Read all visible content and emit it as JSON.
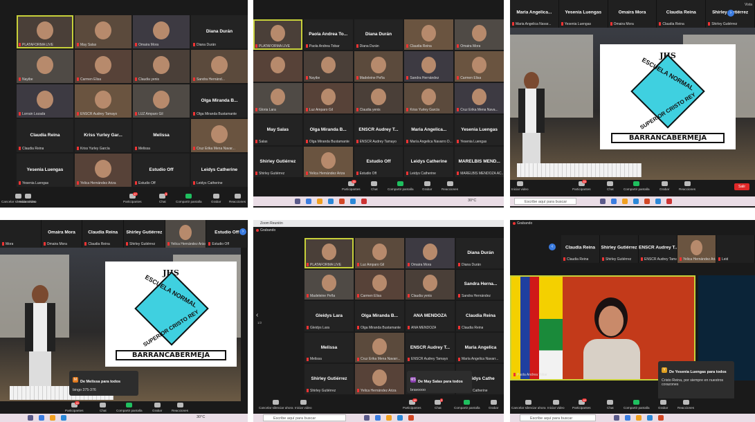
{
  "toolbar": {
    "stop_video": "Iniciar video",
    "cancel_mute": "Cancelar silenciar ahora",
    "participants": "Participantes",
    "chat": "Chat",
    "share": "Compartir pantalla",
    "record": "Grabar",
    "reactions": "Reacciones",
    "leave": "Salir",
    "participants_count_a": "47",
    "participants_count_b": "48",
    "chat_badge": "5"
  },
  "taskbar": {
    "search_placeholder": "Escribe aquí para buscar",
    "temperature": "30°C"
  },
  "window": {
    "title": "Zoom Reunión",
    "recording": "Grabando",
    "view": "Vista"
  },
  "panel1": {
    "tiles": [
      {
        "label": "PLATAFORMA LIVE",
        "name": "",
        "video": true,
        "hl": true
      },
      {
        "label": "May Salas",
        "name": "",
        "video": true
      },
      {
        "label": "Omaira Mora",
        "name": "",
        "video": true
      },
      {
        "label": "Diana Durán",
        "name": "Diana Durán",
        "video": false
      },
      {
        "label": "Nayibe",
        "name": "",
        "video": true
      },
      {
        "label": "Carmen Elisa",
        "name": "",
        "video": true
      },
      {
        "label": "Claudia yenis",
        "name": "",
        "video": true
      },
      {
        "label": "Sandra Hernánd...",
        "name": "",
        "video": true
      },
      {
        "label": "Lorrain Lozada",
        "name": "",
        "video": true
      },
      {
        "label": "ENSCR Audrey Tamayo",
        "name": "",
        "video": true
      },
      {
        "label": "LUZ Amparo Gil",
        "name": "",
        "video": true
      },
      {
        "label": "Olga Miranda Bustamante",
        "name": "Olga Miranda B...",
        "video": false
      },
      {
        "label": "Claudia Reina",
        "name": "Claudia Reina",
        "video": false
      },
      {
        "label": "Kriss Yurley García",
        "name": "Kriss Yurley Gar...",
        "video": false
      },
      {
        "label": "Melissa",
        "name": "Melissa",
        "video": false
      },
      {
        "label": "Cruz Erika Mena Navar...",
        "name": "",
        "video": true
      },
      {
        "label": "Yesenia Luengas",
        "name": "Yesenia Luengas",
        "video": false
      },
      {
        "label": "Yelica Hernández Ariza",
        "name": "",
        "video": true
      },
      {
        "label": "Estudio Off",
        "name": "Estudio Off",
        "video": false
      },
      {
        "label": "Leidys Catherine",
        "name": "Leidys Catherine",
        "video": false
      }
    ]
  },
  "panel2": {
    "tiles": [
      {
        "label": "PLATAFORMA LIVE",
        "name": "",
        "video": true,
        "hl": true
      },
      {
        "label": "Paola Andrea Tobar",
        "name": "Paola Andrea To...",
        "video": false
      },
      {
        "label": "Diana Durán",
        "name": "Diana Durán",
        "video": false
      },
      {
        "label": "Claudia Reina",
        "name": "",
        "video": true
      },
      {
        "label": "Omaira Mora",
        "name": "",
        "video": true
      },
      {
        "label": "",
        "name": "",
        "video": true
      },
      {
        "label": "Nayibe",
        "name": "",
        "video": true
      },
      {
        "label": "Madeleine Peña",
        "name": "",
        "video": true
      },
      {
        "label": "Sandra Hernández",
        "name": "",
        "video": true
      },
      {
        "label": "Carmen Elisa",
        "name": "",
        "video": true
      },
      {
        "label": "Gloria Lara",
        "name": "",
        "video": true
      },
      {
        "label": "Luz Amparo Gil",
        "name": "",
        "video": true
      },
      {
        "label": "Claudia yenis",
        "name": "",
        "video": true
      },
      {
        "label": "Kriss Yurley García",
        "name": "",
        "video": true
      },
      {
        "label": "Cruz Erika Mena Nava...",
        "name": "",
        "video": true
      },
      {
        "label": "Salas",
        "name": "May Salas",
        "video": false
      },
      {
        "label": "Olga Miranda Bustamante",
        "name": "Olga Miranda B...",
        "video": false
      },
      {
        "label": "ENSCR Audrey Tamayo",
        "name": "ENSCR Audrey T...",
        "video": false
      },
      {
        "label": "María Angelica Navarro D...",
        "name": "Maria Angelica...",
        "video": false
      },
      {
        "label": "Yesenia Luengas",
        "name": "Yesenia Luengas",
        "video": false
      },
      {
        "label": "Shirley Gutiérrez",
        "name": "Shirley Gutiérrez",
        "video": false
      },
      {
        "label": "Yelica Hernández Ariza",
        "name": "",
        "video": true
      },
      {
        "label": "Estudio Off",
        "name": "Estudio Off",
        "video": false
      },
      {
        "label": "Leidys Catherine",
        "name": "Leidys Catherine",
        "video": false
      },
      {
        "label": "MARELBIS MENDOZA AC...",
        "name": "MARELBIS MEND...",
        "video": false
      }
    ]
  },
  "panel3": {
    "strip": [
      {
        "name": "Maria Angelica...",
        "label": "Maria Angelica Navar..."
      },
      {
        "name": "Yesenia Luengas",
        "label": "Yesenia Luengas"
      },
      {
        "name": "Omaira Mora",
        "label": "Omaira Mora"
      },
      {
        "name": "Claudia Reina",
        "label": "Claudia Reina"
      },
      {
        "name": "Shirley Gutiérrez",
        "label": "Shirley Gutiérrez"
      }
    ]
  },
  "panel4": {
    "strip": [
      {
        "name": "",
        "label": "Mora",
        "video": false
      },
      {
        "name": "Omaira Mora",
        "label": "Omaira Mora",
        "video": false
      },
      {
        "name": "Claudia Reina",
        "label": "Claudia Reina",
        "video": false
      },
      {
        "name": "Shirley Gutiérrez",
        "label": "Shirley Gutiérrez",
        "video": false
      },
      {
        "name": "",
        "label": "Yelica Hernández Ariza",
        "video": true
      },
      {
        "name": "Estudio Off",
        "label": "Estudio Off",
        "video": false
      }
    ],
    "chat": {
      "from": "De Melissa para todos",
      "msg": "bingo 375-376",
      "initial": "M"
    }
  },
  "panel5": {
    "tiles": [
      {
        "label": "PLATAFORMA LIVE",
        "name": "",
        "video": true,
        "hl": true
      },
      {
        "label": "Luz Amparo Gil",
        "name": "",
        "video": true
      },
      {
        "label": "Omaira Mora",
        "name": "",
        "video": true
      },
      {
        "label": "Diana Durán",
        "name": "Diana Durán",
        "video": false
      },
      {
        "label": "Madeleine Peña",
        "name": "",
        "video": true
      },
      {
        "label": "Carmen Elisa",
        "name": "",
        "video": true
      },
      {
        "label": "Claudia yenis",
        "name": "",
        "video": true
      },
      {
        "label": "Sandra Hernández",
        "name": "Sandra Herna...",
        "video": false
      },
      {
        "label": "Gleidys Lara",
        "name": "Gleidys Lara",
        "video": false
      },
      {
        "label": "Olga Miranda Bustamante",
        "name": "Olga Miranda B...",
        "video": false
      },
      {
        "label": "ANA MENDOZA",
        "name": "ANA MENDOZA",
        "video": false
      },
      {
        "label": "Claudia Reina",
        "name": "Claudia Reina",
        "video": false
      },
      {
        "label": "Melissa",
        "name": "Melissa",
        "video": false
      },
      {
        "label": "Cruz Erika Mena Navarr...",
        "name": "",
        "video": true
      },
      {
        "label": "ENSCR Audrey Tamayo",
        "name": "ENSCR Audrey T...",
        "video": false
      },
      {
        "label": "María Angelica Navarr...",
        "name": "Maria Angelica",
        "video": false
      },
      {
        "label": "Shirley Gutiérrez",
        "name": "Shirley Gutiérrez",
        "video": false
      },
      {
        "label": "Yelica Hernández Ariza",
        "name": "",
        "video": true
      },
      {
        "label": "",
        "name": "",
        "video": false
      },
      {
        "label": "Leidys Catherine",
        "name": "Leidys Cathe",
        "video": false
      }
    ],
    "page": "1/2",
    "chat": {
      "from": "De May Salas para todos",
      "msg": "bravoooo",
      "initial": "MS"
    }
  },
  "panel6": {
    "strip": [
      {
        "name": "Claudia Reina",
        "label": "Claudia Reina",
        "video": false
      },
      {
        "name": "Shirley Gutiérrez",
        "label": "Shirley Gutiérrez",
        "video": false
      },
      {
        "name": "ENSCR Audrey T...",
        "label": "ENSCR Audrey Tamay...",
        "video": false
      },
      {
        "name": "",
        "label": "Yelica Hernández Ariza",
        "video": true
      },
      {
        "name": "",
        "label": "Leid",
        "video": false
      }
    ],
    "speaker_label": "Paola Andrea Tobar",
    "chat": {
      "from": "De Yesenia Luengas para todos",
      "msg": "Cristo Reina, por siempre en nuestros corazones",
      "initial": "Y"
    }
  },
  "logo": {
    "jhs": "JHS",
    "line1": "ESCUELA NORMAL",
    "line2": "SUPERIOR CRISTO REY",
    "city": "BARRANCABERMEJA"
  },
  "colors": {
    "zoom_bg": "#1a1a1a",
    "share_green": "#1fbf5f",
    "active_speaker": "#c8d13a",
    "leave_red": "#e02828",
    "taskbar": "#eadde6"
  }
}
